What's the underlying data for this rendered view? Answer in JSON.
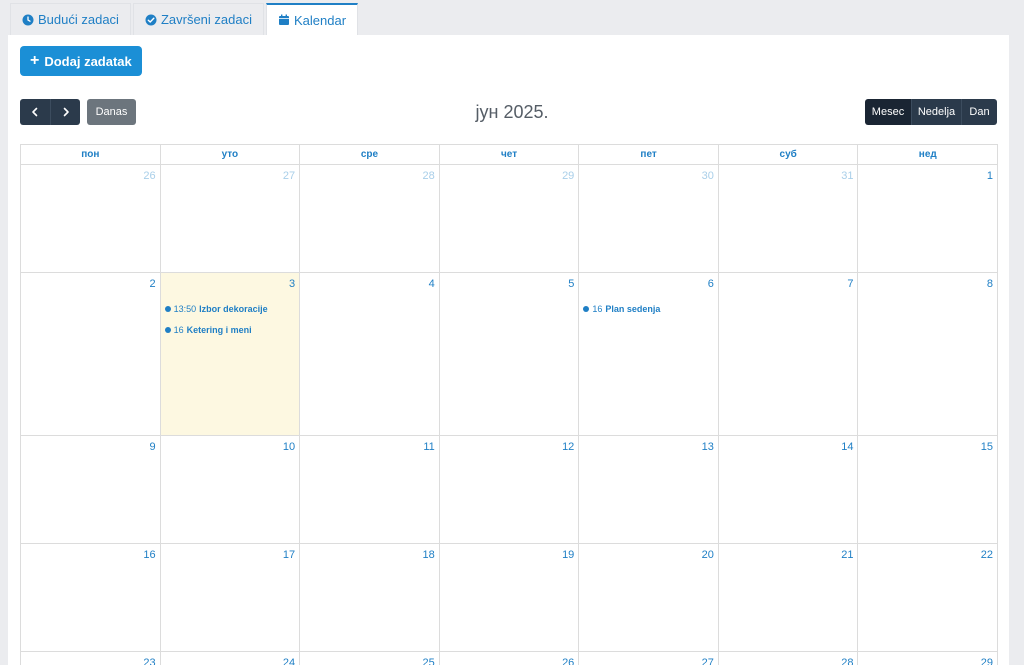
{
  "tabs": [
    {
      "label": "Budući zadaci",
      "icon": "clock-icon",
      "active": false
    },
    {
      "label": "Završeni zadaci",
      "icon": "check-circle-icon",
      "active": false
    },
    {
      "label": "Kalendar",
      "icon": "calendar-icon",
      "active": true
    }
  ],
  "toolbar": {
    "add_label": "Dodaj zadatak",
    "prev_icon": "chevron-left-icon",
    "next_icon": "chevron-right-icon",
    "today_label": "Danas",
    "title": "јун 2025.",
    "views": [
      {
        "label": "Mesec",
        "active": true
      },
      {
        "label": "Nedelja",
        "active": false
      },
      {
        "label": "Dan",
        "active": false
      }
    ]
  },
  "calendar": {
    "weekdays": [
      "пон",
      "уто",
      "сре",
      "чет",
      "пет",
      "суб",
      "нед"
    ],
    "weeks": [
      {
        "days": [
          {
            "num": "26",
            "other": true
          },
          {
            "num": "27",
            "other": true
          },
          {
            "num": "28",
            "other": true
          },
          {
            "num": "29",
            "other": true
          },
          {
            "num": "30",
            "other": true
          },
          {
            "num": "31",
            "other": true
          },
          {
            "num": "1",
            "other": false
          }
        ]
      },
      {
        "days": [
          {
            "num": "2"
          },
          {
            "num": "3",
            "today": true,
            "events": [
              {
                "time": "13:50",
                "title": "Izbor dekoracije"
              },
              {
                "time": "16",
                "title": "Ketering i meni"
              }
            ]
          },
          {
            "num": "4"
          },
          {
            "num": "5"
          },
          {
            "num": "6",
            "events": [
              {
                "time": "16",
                "title": "Plan sedenja"
              }
            ]
          },
          {
            "num": "7"
          },
          {
            "num": "8"
          }
        ]
      },
      {
        "days": [
          {
            "num": "9"
          },
          {
            "num": "10"
          },
          {
            "num": "11"
          },
          {
            "num": "12"
          },
          {
            "num": "13"
          },
          {
            "num": "14"
          },
          {
            "num": "15"
          }
        ]
      },
      {
        "days": [
          {
            "num": "16"
          },
          {
            "num": "17"
          },
          {
            "num": "18"
          },
          {
            "num": "19"
          },
          {
            "num": "20"
          },
          {
            "num": "21"
          },
          {
            "num": "22"
          }
        ]
      },
      {
        "days": [
          {
            "num": "23"
          },
          {
            "num": "24"
          },
          {
            "num": "25"
          },
          {
            "num": "26"
          },
          {
            "num": "27"
          },
          {
            "num": "28"
          },
          {
            "num": "29"
          }
        ]
      }
    ]
  },
  "colors": {
    "accent": "#1f7fc5",
    "primary_button": "#1b8fd6",
    "dark_button": "#2b3a4b",
    "today_bg": "#fdf8e1"
  }
}
